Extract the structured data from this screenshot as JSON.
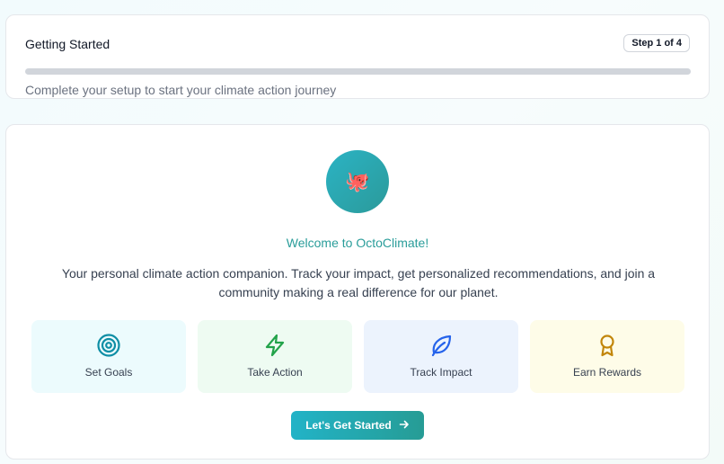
{
  "progress": {
    "title": "Getting Started",
    "step_badge": "Step 1 of 4",
    "percent": 0,
    "subtitle": "Complete your setup to start your climate action journey"
  },
  "welcome": {
    "logo_emoji": "🐙",
    "title": "Welcome to OctoClimate!",
    "description": "Your personal climate action companion. Track your impact, get personalized recommendations, and join a community making a real difference for our planet.",
    "features": [
      {
        "label": "Set Goals",
        "icon": "target-icon",
        "color": "#0e8ea5"
      },
      {
        "label": "Take Action",
        "icon": "lightning-icon",
        "color": "#22a34a"
      },
      {
        "label": "Track Impact",
        "icon": "leaf-icon",
        "color": "#2563eb"
      },
      {
        "label": "Earn Rewards",
        "icon": "award-icon",
        "color": "#c2860a"
      }
    ],
    "cta_label": "Let's Get Started",
    "cta_icon": "arrow-right-icon"
  },
  "colors": {
    "accent": "#22a6b3",
    "title_teal": "#2a9d9a"
  }
}
